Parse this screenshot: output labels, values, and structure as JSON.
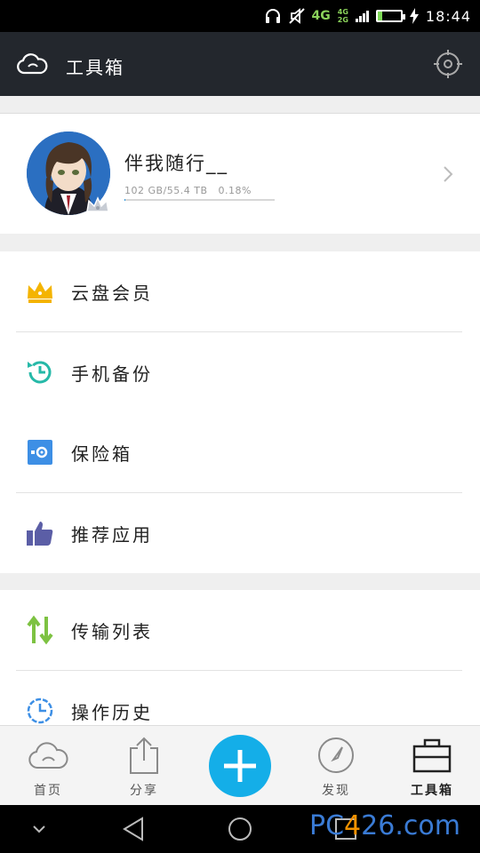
{
  "status_bar": {
    "network": "4G",
    "network_small_top": "4G",
    "network_small_bottom": "2G",
    "battery_level": "19",
    "time": "18:44"
  },
  "header": {
    "title": "工具箱"
  },
  "profile": {
    "username": "伴我随行__",
    "quota_text": "102 GB/55.4 TB   0.18%",
    "quota_fraction": 0.0018
  },
  "menu_group_1": {
    "items": [
      {
        "label": "云盘会员",
        "icon": "crown-icon",
        "color": "#f4b400"
      },
      {
        "label": "手机备份",
        "icon": "backup-clock-icon",
        "color": "#26b9a8"
      },
      {
        "label": "保险箱",
        "icon": "safe-box-icon",
        "color": "#3d8fe5"
      },
      {
        "label": "推荐应用",
        "icon": "thumbs-up-icon",
        "color": "#5b5ea6"
      }
    ]
  },
  "menu_group_2": {
    "items": [
      {
        "label": "传输列表",
        "icon": "transfer-arrows-icon",
        "color": "#7dc242"
      },
      {
        "label": "操作历史",
        "icon": "history-clock-icon",
        "color": "#3d8fe5"
      }
    ]
  },
  "tab_bar": {
    "tabs": [
      {
        "label": "首页",
        "icon": "cloud-icon"
      },
      {
        "label": "分享",
        "icon": "share-icon"
      },
      {
        "label": "",
        "icon": "add-icon"
      },
      {
        "label": "发现",
        "icon": "compass-icon"
      },
      {
        "label": "工具箱",
        "icon": "toolbox-icon",
        "active": true
      }
    ]
  },
  "watermark": {
    "part1": "PC",
    "part2": "4",
    "part3": "26.com"
  },
  "colors": {
    "header_bg": "#23272d",
    "accent": "#14aee8"
  }
}
